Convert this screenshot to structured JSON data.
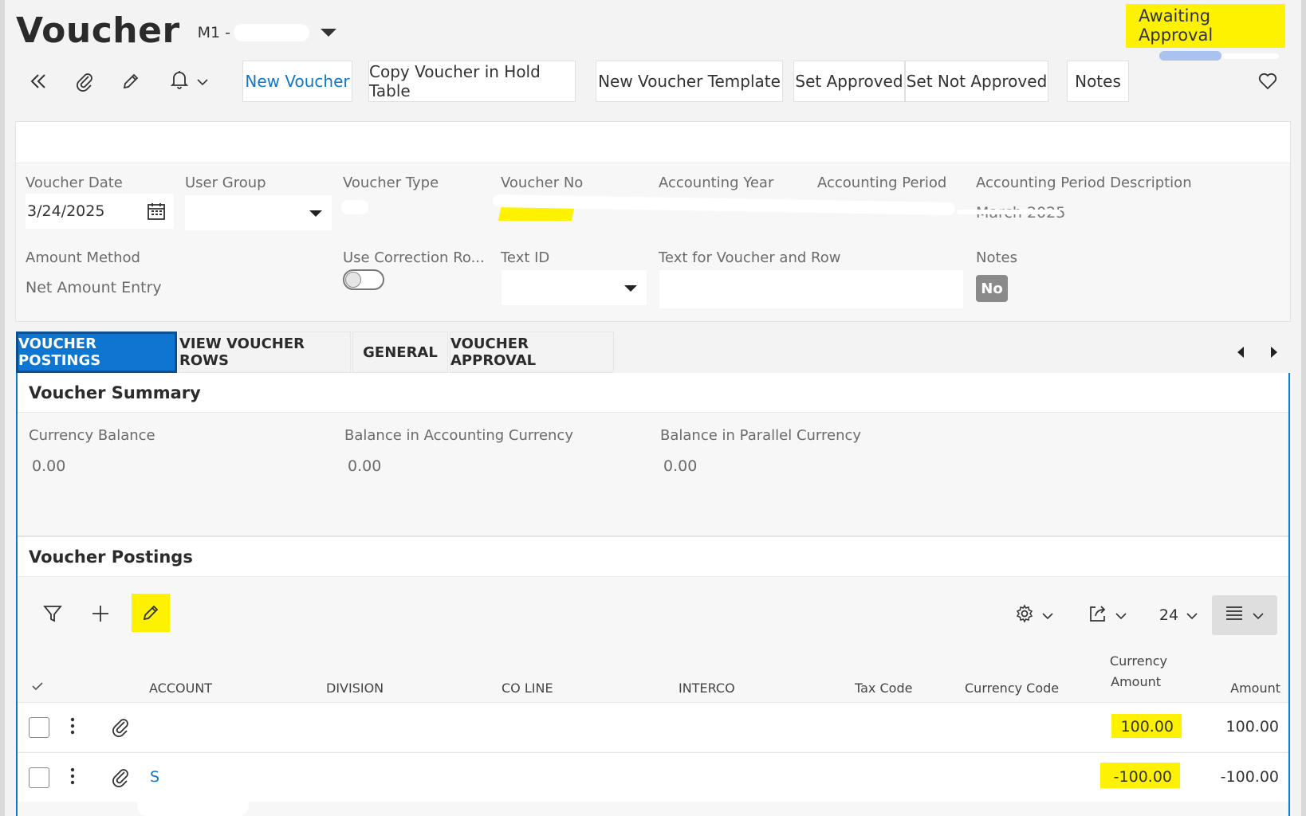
{
  "header": {
    "title": "Voucher",
    "record_prefix": "M1 -",
    "status": "Awaiting Approval",
    "status_progress_fraction": 0.4
  },
  "toolbar": {
    "back_icon": "double-chevron-left-icon",
    "attach_icon": "paperclip-icon",
    "edit_icon": "pencil-icon",
    "bell_icon": "bell-icon",
    "buttons": {
      "new_voucher": "New Voucher",
      "copy_hold": "Copy Voucher in Hold Table",
      "new_template": "New Voucher Template",
      "set_approved": "Set Approved",
      "set_not_approved": "Set Not Approved",
      "notes": "Notes"
    },
    "favorite_icon": "heart-icon"
  },
  "form": {
    "voucher_date": {
      "label": "Voucher Date",
      "value": "3/24/2025"
    },
    "user_group": {
      "label": "User Group",
      "value": ""
    },
    "voucher_type": {
      "label": "Voucher Type"
    },
    "voucher_no": {
      "label": "Voucher No"
    },
    "accounting_year": {
      "label": "Accounting Year"
    },
    "accounting_period": {
      "label": "Accounting Period"
    },
    "accounting_period_desc": {
      "label": "Accounting Period Description",
      "value": "March 2025"
    },
    "amount_method": {
      "label": "Amount Method",
      "value": "Net Amount Entry"
    },
    "use_correction": {
      "label": "Use Correction Ro...",
      "on": false
    },
    "text_id": {
      "label": "Text ID",
      "value": ""
    },
    "text_voucher_row": {
      "label": "Text for Voucher and Row",
      "value": ""
    },
    "notes": {
      "label": "Notes",
      "value": "No"
    }
  },
  "tabs": [
    {
      "label": "VOUCHER POSTINGS",
      "active": true
    },
    {
      "label": "VIEW VOUCHER ROWS",
      "active": false
    },
    {
      "label": "GENERAL",
      "active": false
    },
    {
      "label": "VOUCHER APPROVAL",
      "active": false
    }
  ],
  "summary": {
    "title": "Voucher Summary",
    "currency_balance": {
      "label": "Currency Balance",
      "value": "0.00"
    },
    "balance_accounting": {
      "label": "Balance in Accounting Currency",
      "value": "0.00"
    },
    "balance_parallel": {
      "label": "Balance in Parallel Currency",
      "value": "0.00"
    }
  },
  "postings": {
    "title": "Voucher Postings",
    "page_size": "24",
    "columns": {
      "account": "ACCOUNT",
      "division": "DIVISION",
      "co_line": "CO LINE",
      "interco": "INTERCO",
      "tax_code": "Tax Code",
      "currency_code": "Currency Code",
      "currency_amount_1": "Currency",
      "currency_amount_2": "Amount",
      "amount": "Amount"
    },
    "rows": [
      {
        "currency_amount": "100.00",
        "amount": "100.00"
      },
      {
        "currency_amount": "-100.00",
        "amount": "-100.00",
        "account_fragment": "S"
      }
    ]
  },
  "colors": {
    "accent": "#0e76d0",
    "highlight": "#fff200",
    "link": "#1476c6"
  }
}
